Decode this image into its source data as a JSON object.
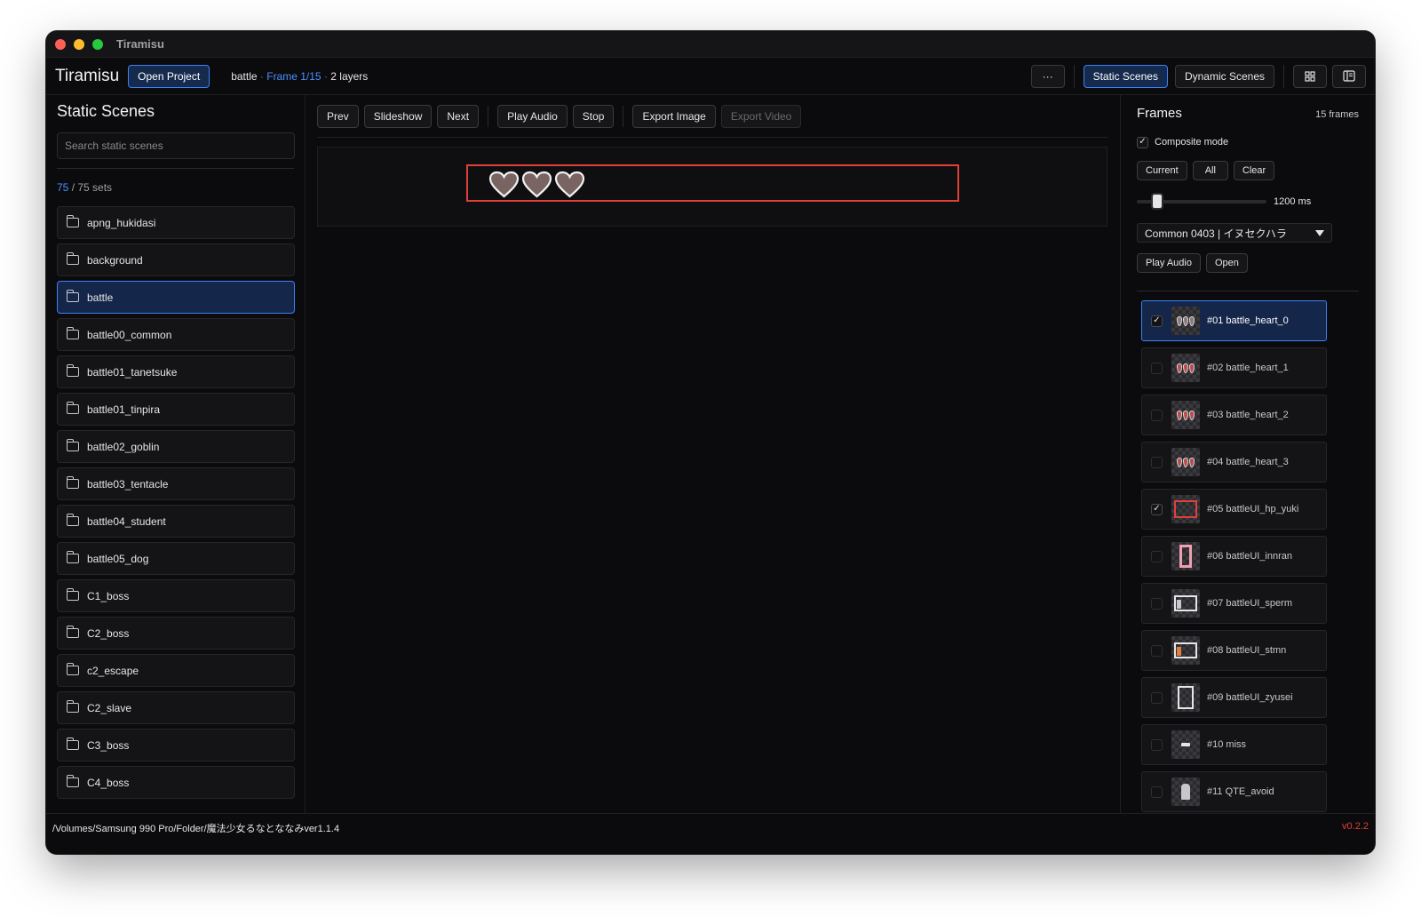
{
  "window": {
    "title": "Tiramisu"
  },
  "header": {
    "app_name": "Tiramisu",
    "open_project": "Open Project",
    "scene": "battle",
    "frame": "Frame 1/15",
    "layers": "2 layers",
    "more": "···",
    "static_scenes": "Static Scenes",
    "dynamic_scenes": "Dynamic Scenes"
  },
  "sidebar": {
    "title": "Static Scenes",
    "search_placeholder": "Search static scenes",
    "count_visible": "75",
    "count_total": "/ 75 sets",
    "items": [
      {
        "label": "apng_hukidasi",
        "selected": false
      },
      {
        "label": "background",
        "selected": false
      },
      {
        "label": "battle",
        "selected": true
      },
      {
        "label": "battle00_common",
        "selected": false
      },
      {
        "label": "battle01_tanetsuke",
        "selected": false
      },
      {
        "label": "battle01_tinpira",
        "selected": false
      },
      {
        "label": "battle02_goblin",
        "selected": false
      },
      {
        "label": "battle03_tentacle",
        "selected": false
      },
      {
        "label": "battle04_student",
        "selected": false
      },
      {
        "label": "battle05_dog",
        "selected": false
      },
      {
        "label": "C1_boss",
        "selected": false
      },
      {
        "label": "C2_boss",
        "selected": false
      },
      {
        "label": "c2_escape",
        "selected": false
      },
      {
        "label": "C2_slave",
        "selected": false
      },
      {
        "label": "C3_boss",
        "selected": false
      },
      {
        "label": "C4_boss",
        "selected": false
      }
    ]
  },
  "toolbar": {
    "prev": "Prev",
    "slideshow": "Slideshow",
    "next": "Next",
    "play_audio": "Play Audio",
    "stop": "Stop",
    "export_image": "Export Image",
    "export_video": "Export Video"
  },
  "frames_panel": {
    "title": "Frames",
    "count": "15 frames",
    "composite_label": "Composite mode",
    "composite_checked": true,
    "current": "Current",
    "all": "All",
    "clear": "Clear",
    "duration": "1200 ms",
    "duration_fraction": 0.16,
    "audio_select": "Common 0403 | イヌセクハラ",
    "play_audio": "Play Audio",
    "open": "Open",
    "items": [
      {
        "label": "#01 battle_heart_0",
        "checked": true,
        "selected": true,
        "thumb": "hearts-grey"
      },
      {
        "label": "#02 battle_heart_1",
        "checked": false,
        "selected": false,
        "thumb": "hearts"
      },
      {
        "label": "#03 battle_heart_2",
        "checked": false,
        "selected": false,
        "thumb": "hearts"
      },
      {
        "label": "#04 battle_heart_3",
        "checked": false,
        "selected": false,
        "thumb": "hearts"
      },
      {
        "label": "#05 battleUI_hp_yuki",
        "checked": true,
        "selected": false,
        "thumb": "red-box"
      },
      {
        "label": "#06 battleUI_innran",
        "checked": false,
        "selected": false,
        "thumb": "pink-bar"
      },
      {
        "label": "#07 battleUI_sperm",
        "checked": false,
        "selected": false,
        "thumb": "wide-frame"
      },
      {
        "label": "#08 battleUI_stmn",
        "checked": false,
        "selected": false,
        "thumb": "wide-frame-orange"
      },
      {
        "label": "#09 battleUI_zyusei",
        "checked": false,
        "selected": false,
        "thumb": "tall-frame"
      },
      {
        "label": "#10 miss",
        "checked": false,
        "selected": false,
        "thumb": "miss"
      },
      {
        "label": "#11 QTE_avoid",
        "checked": false,
        "selected": false,
        "thumb": "figure"
      }
    ]
  },
  "status": {
    "path": "/Volumes/Samsung 990 Pro/Folder/魔法少女るなとななみver1.1.4",
    "version": "v0.2.2"
  },
  "colors": {
    "accent": "#3b82f6",
    "hp_frame": "#e0403a",
    "version": "#e0403a"
  }
}
